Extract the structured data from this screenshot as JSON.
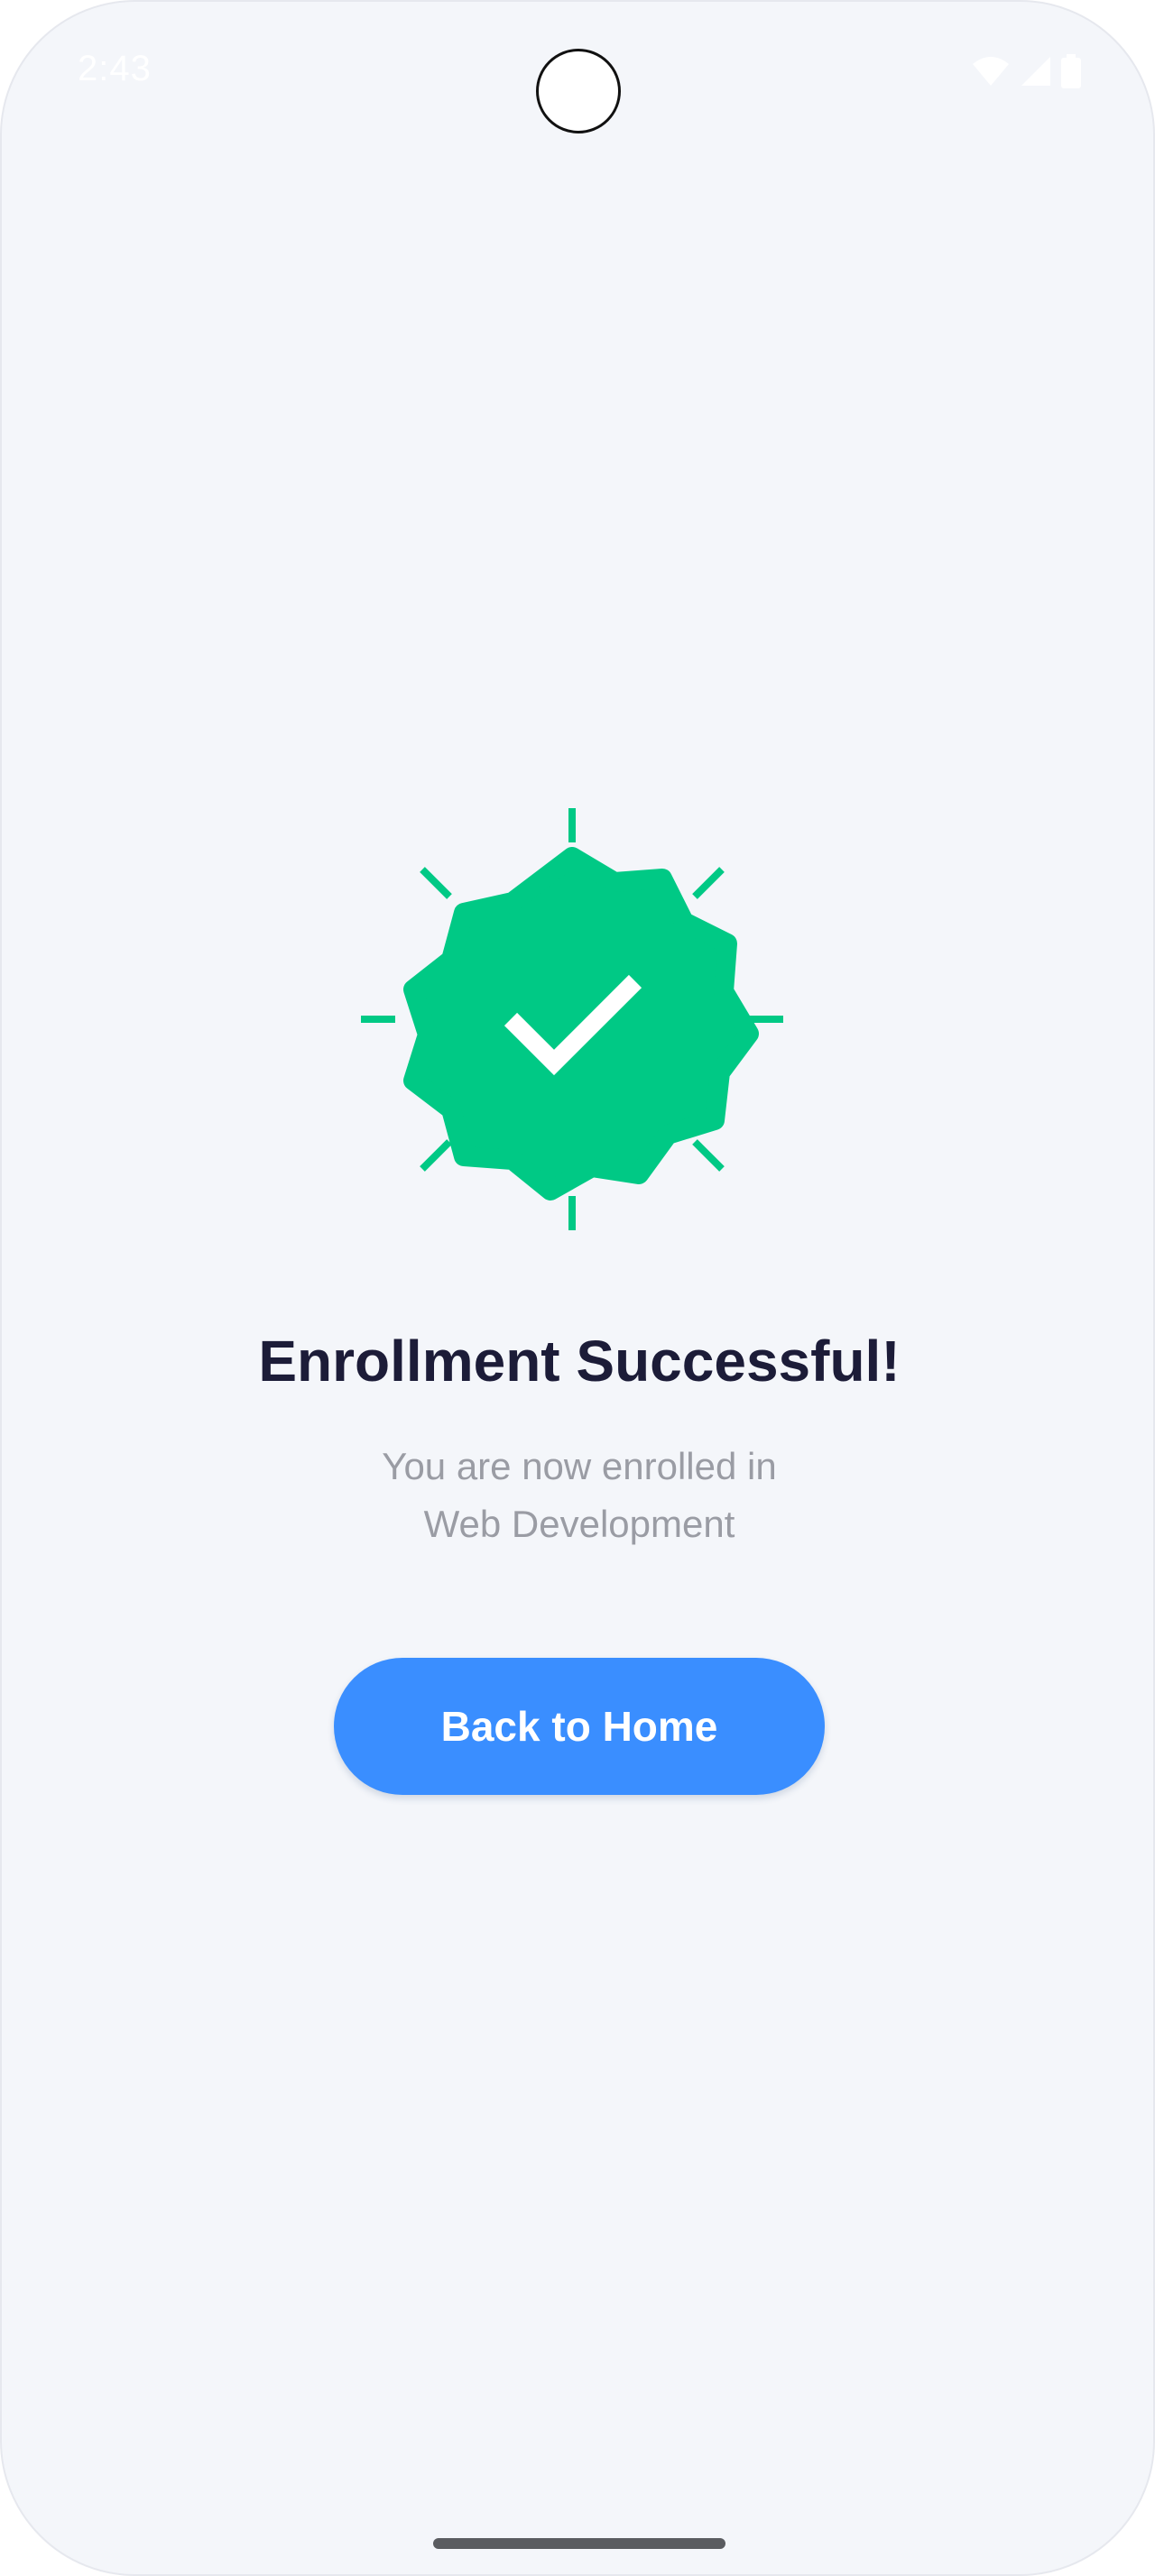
{
  "status_bar": {
    "time": "2:43",
    "icons": [
      "wifi-icon",
      "signal-icon",
      "battery-icon"
    ]
  },
  "success": {
    "icon": "verified-badge-check-icon",
    "title": "Enrollment Successful!",
    "message_line_1": "You are now enrolled in",
    "message_line_2": "Web Development"
  },
  "actions": {
    "back_home_label": "Back to Home"
  },
  "colors": {
    "background": "#f4f6fa",
    "badge_green": "#00c985",
    "button_blue": "#3a8eff",
    "title_text": "#1c1c38",
    "subtitle_text": "#9a9ca4"
  }
}
